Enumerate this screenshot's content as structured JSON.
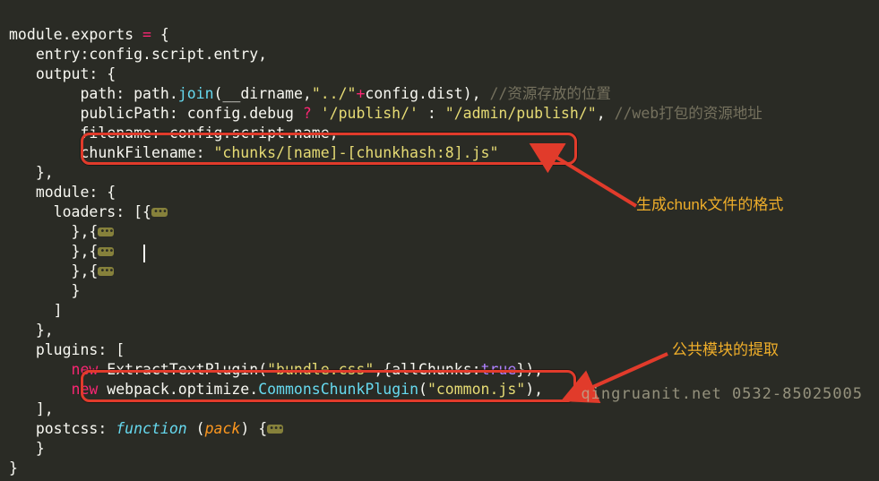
{
  "code": {
    "l1": {
      "t1": "module",
      "t2": ".",
      "t3": "exports",
      "t4": " ",
      "op": "=",
      "t5": " {"
    },
    "l2": {
      "pad": "   ",
      "p": "entry",
      "c": ":",
      "v": "config.script.entry,",
      "v1": "config",
      "v2": ".script.entry,"
    },
    "l3": {
      "pad": "   ",
      "p": "output",
      "c": ": {"
    },
    "l4": {
      "pad": "        ",
      "p": "path",
      "c": ": path.",
      "m": "join",
      "a": "(",
      "arg1": "__dirname",
      "comma": ",",
      "s": "\"../\"",
      "op": "+",
      "tail": "config.dist), ",
      "com": "//资源存放的位置"
    },
    "l5": {
      "pad": "        ",
      "p": "publicPath",
      "c": ": config.debug ",
      "q": "?",
      "s1": " '/publish/' ",
      "col": ": ",
      "s2": "\"/admin/publish/\"",
      "comma": ", ",
      "com": "//web打包的资源地址"
    },
    "l6": {
      "pad": "        ",
      "p": "filename",
      "c": ": config.script.name,"
    },
    "l7": {
      "pad": "        ",
      "p": "chunkFilename",
      "c": ": ",
      "s": "\"chunks/[name]-[chunkhash:8].js\""
    },
    "l8": {
      "pad": "   ",
      "c": "},"
    },
    "l9": {
      "pad": "   ",
      "p": "module",
      "c": ": {"
    },
    "l10": {
      "pad": "     ",
      "p": "loaders",
      "c": ": [{"
    },
    "l11": {
      "pad": "       ",
      "c": "},{"
    },
    "l12": {
      "pad": "       ",
      "c": "},{"
    },
    "l13": {
      "pad": "       ",
      "c": "},{"
    },
    "l14": {
      "pad": "       ",
      "c": "}"
    },
    "l15": {
      "pad": "     ",
      "c": "]"
    },
    "l16": {
      "pad": "   ",
      "c": "},"
    },
    "l17": {
      "pad": "   ",
      "p": "plugins",
      "c": ": ["
    },
    "l18": {
      "pad": "       ",
      "kw": "new",
      "sp": " ",
      "n": "ExtractTextPlugin",
      "a": "(",
      "s": "\"bundle.css\"",
      "mid": ",{",
      "attr": "allChunks",
      "col": ":",
      "b": "true",
      "end": "}),"
    },
    "l19": {
      "pad": "       ",
      "kw": "new",
      "sp": " ",
      "n": "webpack.optimize.",
      "m": "CommonsChunkPlugin",
      "a": "(",
      "s": "\"common.js\"",
      "end": "),"
    },
    "l20": {
      "pad": "   ",
      "c": "],"
    },
    "l21": {
      "pad": "   ",
      "p": "postcss",
      "c": ": ",
      "kw": "function",
      "sp": " ",
      "a": "(",
      "arg": "pack",
      "b": ") {"
    },
    "l22": {
      "pad": "   ",
      "c": "}"
    },
    "l23": {
      "c": "}"
    }
  },
  "annotations": {
    "a1": "生成chunk文件的格式",
    "a2": "公共模块的提取"
  },
  "watermark": "qingruanit.net 0532-85025005",
  "chart_data": {
    "type": "none"
  }
}
